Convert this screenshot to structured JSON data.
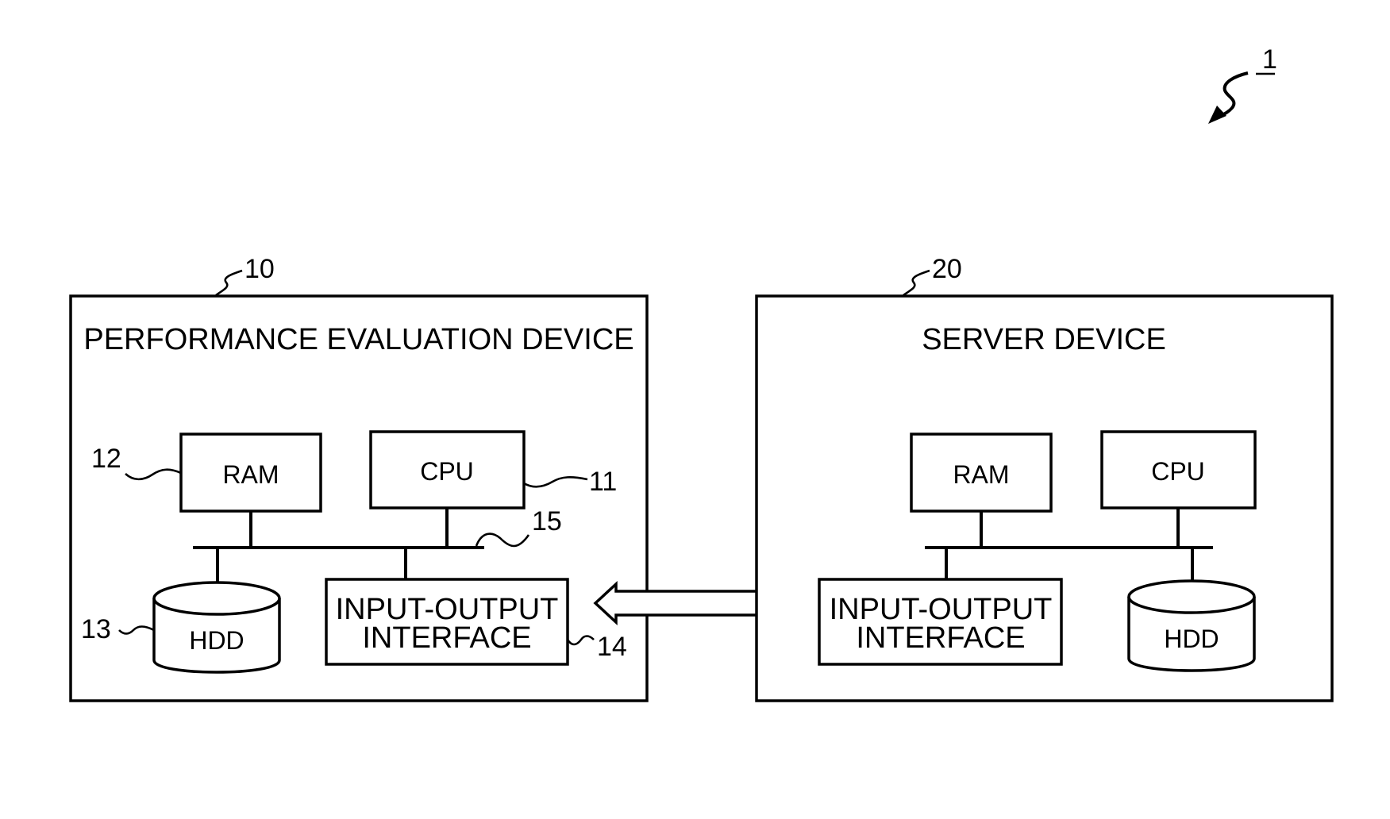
{
  "figure": {
    "system_ref": "1",
    "devices": [
      {
        "id": "performance-evaluation-device",
        "ref": "10",
        "title": "PERFORMANCE EVALUATION DEVICE",
        "components": {
          "ram": {
            "label": "RAM",
            "ref": "12"
          },
          "cpu": {
            "label": "CPU",
            "ref": "11"
          },
          "hdd": {
            "label": "HDD",
            "ref": "13"
          },
          "io": {
            "label_line1": "INPUT-OUTPUT",
            "label_line2": "INTERFACE",
            "ref": "14"
          },
          "bus": {
            "ref": "15"
          }
        }
      },
      {
        "id": "server-device",
        "ref": "20",
        "title": "SERVER DEVICE",
        "components": {
          "ram": {
            "label": "RAM"
          },
          "cpu": {
            "label": "CPU"
          },
          "hdd": {
            "label": "HDD"
          },
          "io": {
            "label_line1": "INPUT-OUTPUT",
            "label_line2": "INTERFACE"
          }
        }
      }
    ],
    "connection": {
      "type": "bidirectional-arrow",
      "from": "performance-evaluation-device",
      "to": "server-device"
    }
  }
}
